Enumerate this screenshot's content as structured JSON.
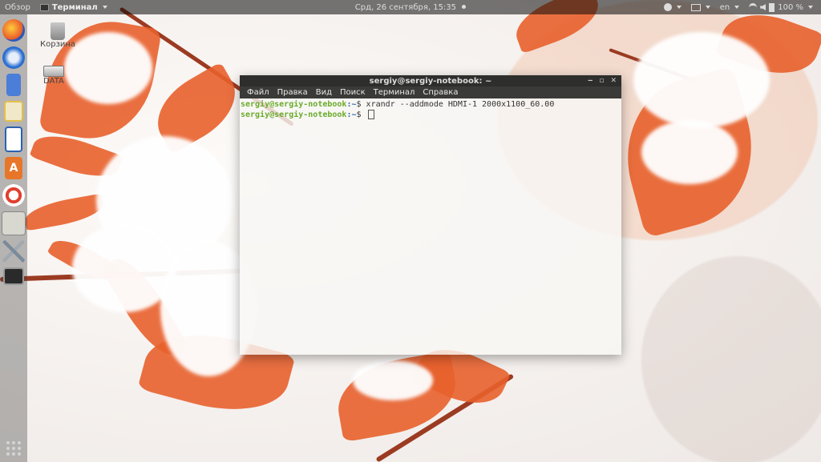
{
  "topbar": {
    "activities": "Обзор",
    "app_menu": "Терминал",
    "clock": "Срд, 26 сентября, 15:35",
    "language": "en",
    "battery": "100 %"
  },
  "desktop": {
    "trash": "Корзина",
    "drive": "DATA"
  },
  "terminal": {
    "title": "sergiy@sergiy-notebook: ~",
    "menu": [
      "Файл",
      "Правка",
      "Вид",
      "Поиск",
      "Терминал",
      "Справка"
    ],
    "lines": [
      {
        "prompt": "sergiy@sergiy-notebook",
        "path": ":~",
        "symbol": "$ ",
        "command": "xrandr --addmode HDMI-1 2000x1100_60.00"
      },
      {
        "prompt": "sergiy@sergiy-notebook",
        "path": ":~",
        "symbol": "$ ",
        "command": ""
      }
    ]
  },
  "dock": {
    "apps": [
      "firefox-icon",
      "thunderbird-icon",
      "files-icon",
      "rhythmbox-icon",
      "writer-icon",
      "software-center-icon",
      "help-icon",
      "audio-icon",
      "settings-icon",
      "terminal-icon"
    ]
  }
}
